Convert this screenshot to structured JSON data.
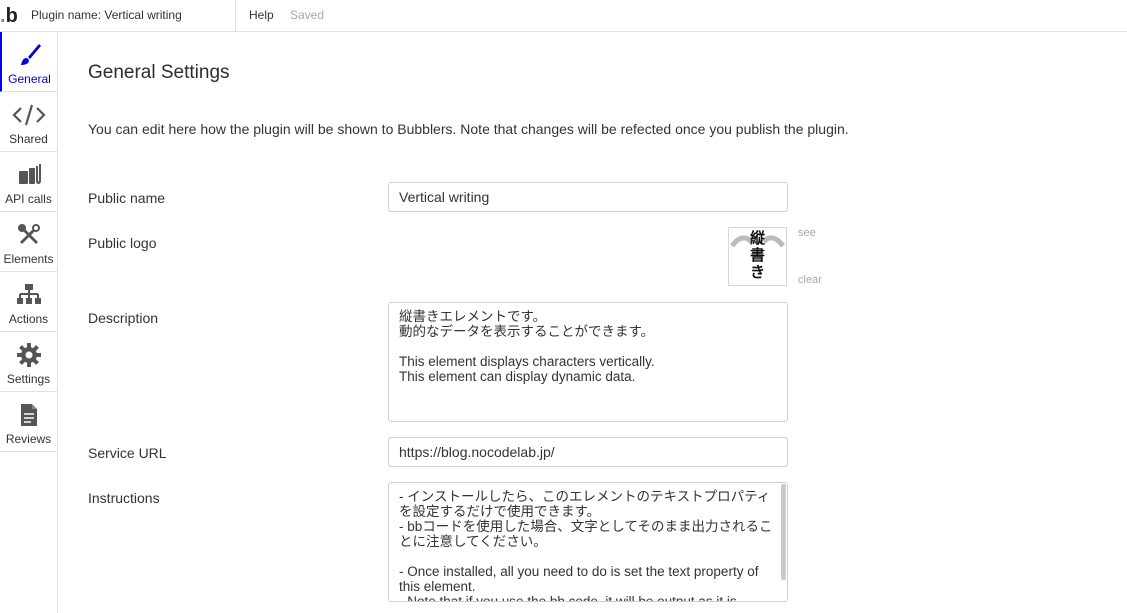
{
  "topbar": {
    "logo_text": "b",
    "plugin_name": "Plugin name: Vertical writing",
    "help_label": "Help",
    "saved_label": "Saved"
  },
  "sidebar": {
    "items": [
      {
        "label": "General",
        "icon": "brush-icon",
        "active": true
      },
      {
        "label": "Shared",
        "icon": "code-icon",
        "active": false
      },
      {
        "label": "API calls",
        "icon": "plug-icon",
        "active": false
      },
      {
        "label": "Elements",
        "icon": "tools-icon",
        "active": false
      },
      {
        "label": "Actions",
        "icon": "workflow-icon",
        "active": false
      },
      {
        "label": "Settings",
        "icon": "gear-icon",
        "active": false
      },
      {
        "label": "Reviews",
        "icon": "document-icon",
        "active": false
      }
    ]
  },
  "main": {
    "title": "General Settings",
    "intro": "You can edit here how the plugin will be shown to Bubblers. Note that changes will be refected once you publish the plugin.",
    "fields": {
      "public_name": {
        "label": "Public name",
        "value": "Vertical writing"
      },
      "public_logo": {
        "label": "Public logo",
        "see_label": "see",
        "clear_label": "clear",
        "logo_text": "縦書き"
      },
      "description": {
        "label": "Description",
        "value": "縦書きエレメントです。\n動的なデータを表示することができます。\n\nThis element displays characters vertically.\nThis element can display dynamic data."
      },
      "service_url": {
        "label": "Service URL",
        "value": "https://blog.nocodelab.jp/"
      },
      "instructions": {
        "label": "Instructions",
        "value": "- インストールしたら、このエレメントのテキストプロパティを設定するだけで使用できます。\n- bbコードを使用した場合、文字としてそのまま出力されることに注意してください。\n\n- Once installed, all you need to do is set the text property of this element.\n- Note that if you use the bb code, it will be output as it is"
      }
    }
  },
  "colors": {
    "accent": "#0205d3",
    "border": "#cfcfcf",
    "muted": "#a8a8a8"
  }
}
